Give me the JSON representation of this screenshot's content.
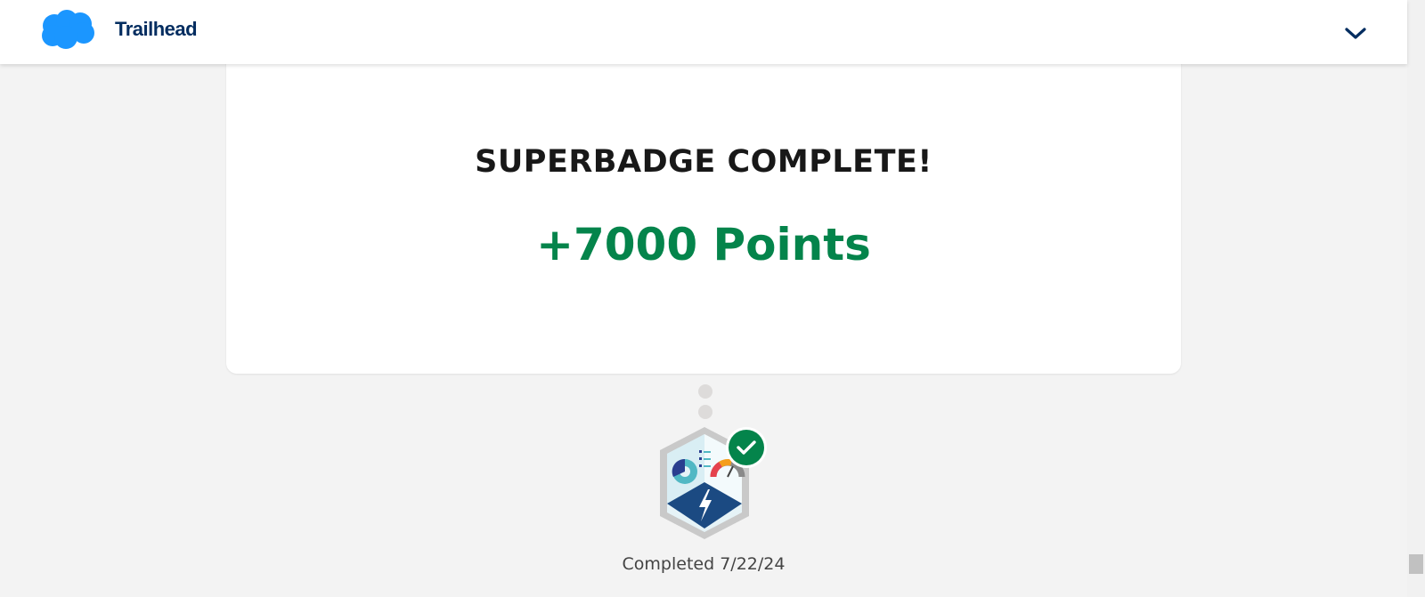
{
  "header": {
    "brand": "Trailhead",
    "logo_icon": "salesforce-cloud-icon",
    "menu_icon": "chevron-down-icon"
  },
  "card": {
    "title": "SUPERBADGE COMPLETE!",
    "points": "+7000 Points"
  },
  "badge": {
    "icon": "superbadge-icon",
    "status_icon": "checkmark-icon",
    "completed_text": "Completed 7/22/24"
  },
  "colors": {
    "brand_blue": "#1b96ff",
    "brand_text": "#032d60",
    "points_green": "#04844b",
    "check_green": "#04844b",
    "badge_navy": "#1b4a82"
  }
}
